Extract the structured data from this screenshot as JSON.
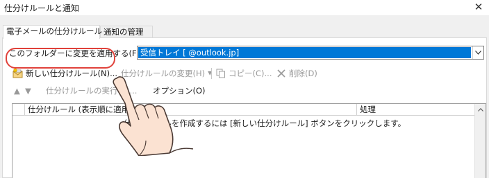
{
  "window": {
    "title": "仕分けルールと通知"
  },
  "tabs": [
    {
      "label": "電子メールの仕分けルール",
      "active": true
    },
    {
      "label": "通知の管理",
      "active": false
    }
  ],
  "apply_folder": {
    "label": "このフォルダーに変更を適用する(F):",
    "value": "受信トレイ [          @outlook.jp]"
  },
  "toolbar": {
    "new_rule": "新しい仕分けルール(N)...",
    "change_rule": "仕分けルールの変更(H)",
    "copy": "コピー(C)...",
    "delete": "削除(D)"
  },
  "sub_toolbar": {
    "up": "▲",
    "down": "▼",
    "run_rules": "仕分けルールの実行(R)...",
    "options": "オプション(O)"
  },
  "table": {
    "columns": [
      "仕分けルール (表示順に適用)",
      "処理"
    ],
    "empty_message": "仕分けルールを作成するには [新しい仕分けルール] ボタンをクリックします。"
  },
  "colors": {
    "accent": "#0078d7",
    "highlight_ring": "#e0413a"
  },
  "icons": [
    "close-icon",
    "new-rule-icon",
    "copy-icon",
    "delete-icon",
    "hand-pointer-icon"
  ]
}
